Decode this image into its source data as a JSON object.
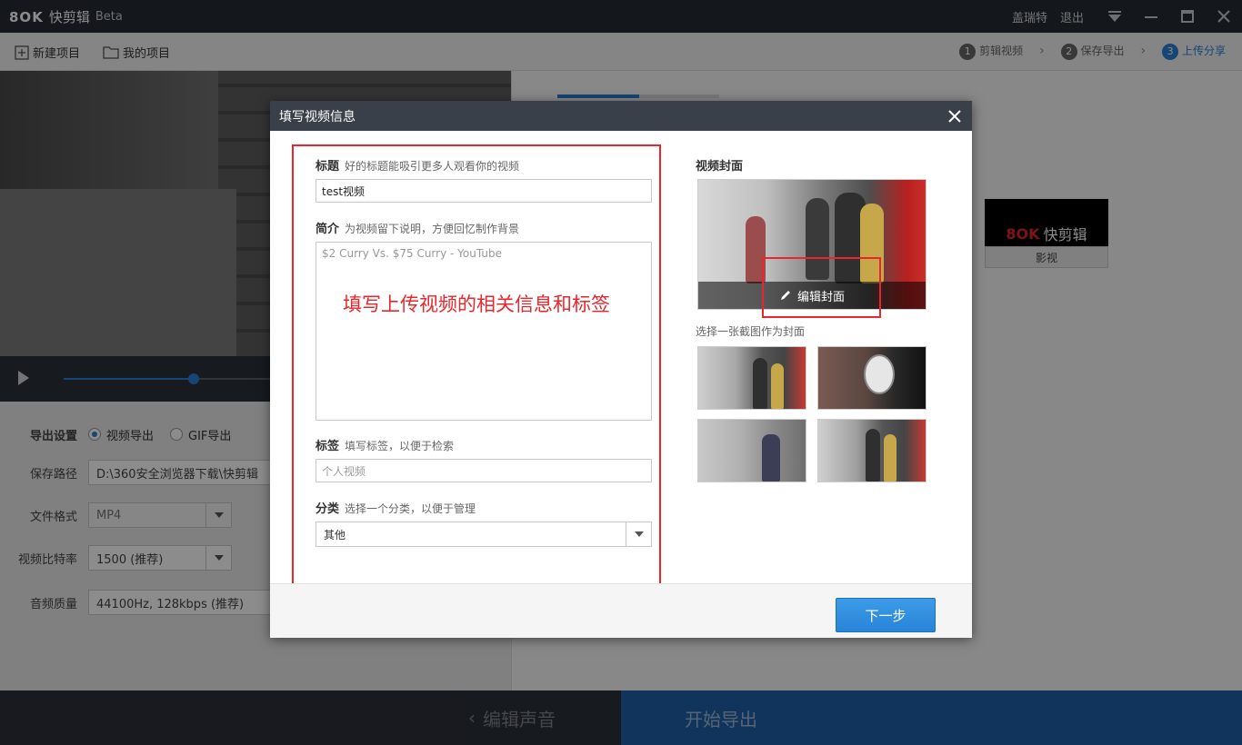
{
  "app": {
    "logo_mark": "8OK",
    "name": "快剪辑",
    "edition": "Beta",
    "user": "盖瑞特",
    "logout": "退出"
  },
  "toolbar": {
    "new_project": "新建项目",
    "my_projects": "我的项目",
    "steps": [
      {
        "num": "1",
        "label": "剪辑视频"
      },
      {
        "num": "2",
        "label": "保存导出"
      },
      {
        "num": "3",
        "label": "上传分享"
      }
    ]
  },
  "export": {
    "section_label": "导出设置",
    "opt_video": "视频导出",
    "opt_gif": "GIF导出",
    "path_label": "保存路径",
    "path_value": "D:\\360安全浏览器下载\\快剪辑",
    "format_label": "文件格式",
    "format_value": "MP4",
    "bitrate_label": "视频比特率",
    "bitrate_value": "1500 (推荐)",
    "audio_label": "音频质量",
    "audio_value": "44100Hz, 128kbps (推荐)"
  },
  "right_panel": {
    "tile_logo": "8OK",
    "tile_name": "快剪辑",
    "tile_label": "影视"
  },
  "player": {
    "progress": 0.29
  },
  "bottom": {
    "back": "编辑声音",
    "export": "开始导出"
  },
  "dialog": {
    "title": "填写视频信息",
    "title_label": "标题",
    "title_hint": "好的标题能吸引更多人观看你的视频",
    "title_value": "test视频",
    "intro_label": "简介",
    "intro_hint": "为视频留下说明，方便回忆制作背景",
    "intro_value": "$2 Curry Vs. $75 Curry - YouTube",
    "annotation": "填写上传视频的相关信息和标签",
    "tags_label": "标签",
    "tags_hint": "填写标签，以便于检索",
    "tags_value": "个人视频",
    "category_label": "分类",
    "category_hint": "选择一个分类，以便于管理",
    "category_value": "其他",
    "cover_title": "视频封面",
    "cover_edit": "编辑封面",
    "cover_hint": "选择一张截图作为封面",
    "next": "下一步"
  },
  "colors": {
    "accent": "#2a7fd6",
    "annotation_red": "#e8262b",
    "titlebar": "#262c33"
  }
}
